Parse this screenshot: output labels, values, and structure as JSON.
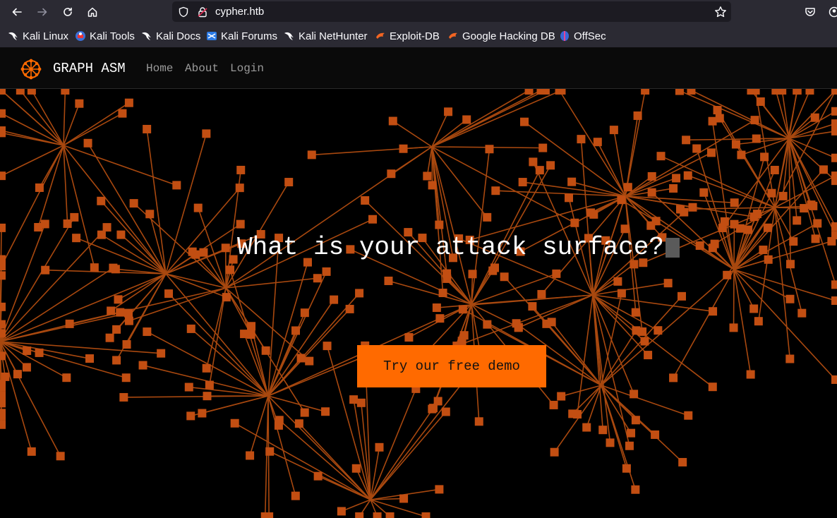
{
  "browser": {
    "url": "cypher.htb",
    "bookmarks": [
      {
        "label": "Kali Linux",
        "icon": "kali-dragon-icon"
      },
      {
        "label": "Kali Tools",
        "icon": "kali-tools-icon"
      },
      {
        "label": "Kali Docs",
        "icon": "kali-dragon-icon"
      },
      {
        "label": "Kali Forums",
        "icon": "kali-forums-icon"
      },
      {
        "label": "Kali NetHunter",
        "icon": "kali-dragon-icon"
      },
      {
        "label": "Exploit-DB",
        "icon": "exploit-db-icon"
      },
      {
        "label": "Google Hacking DB",
        "icon": "exploit-db-icon"
      },
      {
        "label": "OffSec",
        "icon": "offsec-icon"
      }
    ]
  },
  "nav": {
    "brand": "GRAPH ASM",
    "links": [
      "Home",
      "About",
      "Login"
    ]
  },
  "hero": {
    "headline": "What is your attack surface?",
    "cta_label": "Try our free demo"
  },
  "colors": {
    "accent": "#ff6a00",
    "graph_node": "#c24e12",
    "graph_edge": "#a8480f",
    "background": "#000000"
  }
}
